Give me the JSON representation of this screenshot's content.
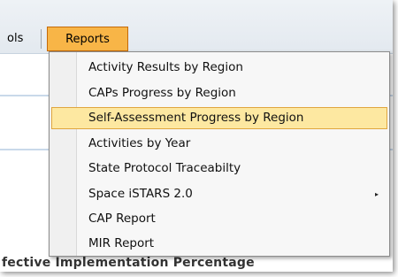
{
  "menubar": {
    "tools_label": "ols",
    "reports_label": "Reports"
  },
  "dropdown": {
    "items": [
      {
        "label": "Activity Results by Region"
      },
      {
        "label": "CAPs Progress by Region"
      },
      {
        "label": "Self-Assessment Progress by Region"
      },
      {
        "label": "Activities by Year"
      },
      {
        "label": "State Protocol Traceabilty"
      },
      {
        "label": "Space iSTARS 2.0",
        "submenu_arrow": "▸"
      },
      {
        "label": "CAP Report"
      },
      {
        "label": "MIR Report"
      }
    ]
  },
  "background": {
    "section_title": "fective Implementation Percentage"
  },
  "colors": {
    "active_menu_bg": "#f8b547",
    "highlight_row_bg": "#fde8a1",
    "highlight_row_border": "#e0a63f"
  }
}
